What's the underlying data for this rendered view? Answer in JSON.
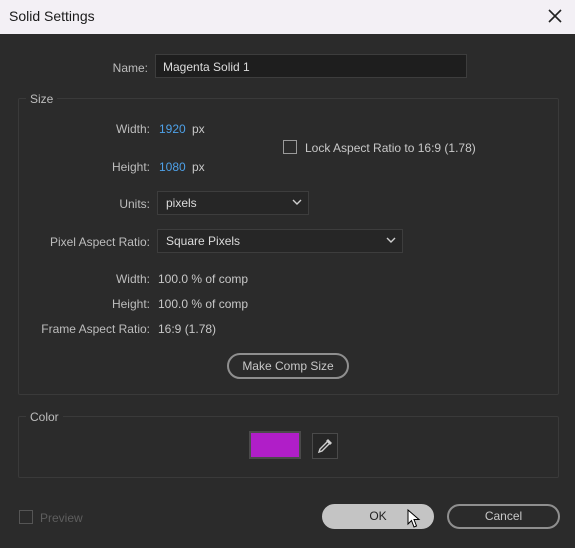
{
  "window": {
    "title": "Solid Settings"
  },
  "name_field": {
    "label": "Name:",
    "value": "Magenta Solid 1"
  },
  "size": {
    "section_title": "Size",
    "width_label": "Width:",
    "width_value": "1920",
    "width_unit": "px",
    "height_label": "Height:",
    "height_value": "1080",
    "height_unit": "px",
    "lock_label": "Lock Aspect Ratio to 16:9 (1.78)",
    "lock_checked": false,
    "units_label": "Units:",
    "units_value": "pixels",
    "par_label": "Pixel Aspect Ratio:",
    "par_value": "Square Pixels",
    "pct_width_label": "Width:",
    "pct_width_value": "100.0 % of comp",
    "pct_height_label": "Height:",
    "pct_height_value": "100.0 % of comp",
    "frame_aspect_label": "Frame Aspect Ratio:",
    "frame_aspect_value": "16:9 (1.78)",
    "make_comp_button": "Make Comp Size"
  },
  "color": {
    "section_title": "Color",
    "swatch_hex": "#b01ec8"
  },
  "footer": {
    "preview_label": "Preview",
    "ok_label": "OK",
    "cancel_label": "Cancel"
  },
  "theme": {
    "accent_blue": "#4ea1e8",
    "background": "#2b2b2b"
  },
  "icons": [
    "close-icon",
    "chevron-down-icon",
    "eyedropper-icon",
    "cursor-icon"
  ]
}
